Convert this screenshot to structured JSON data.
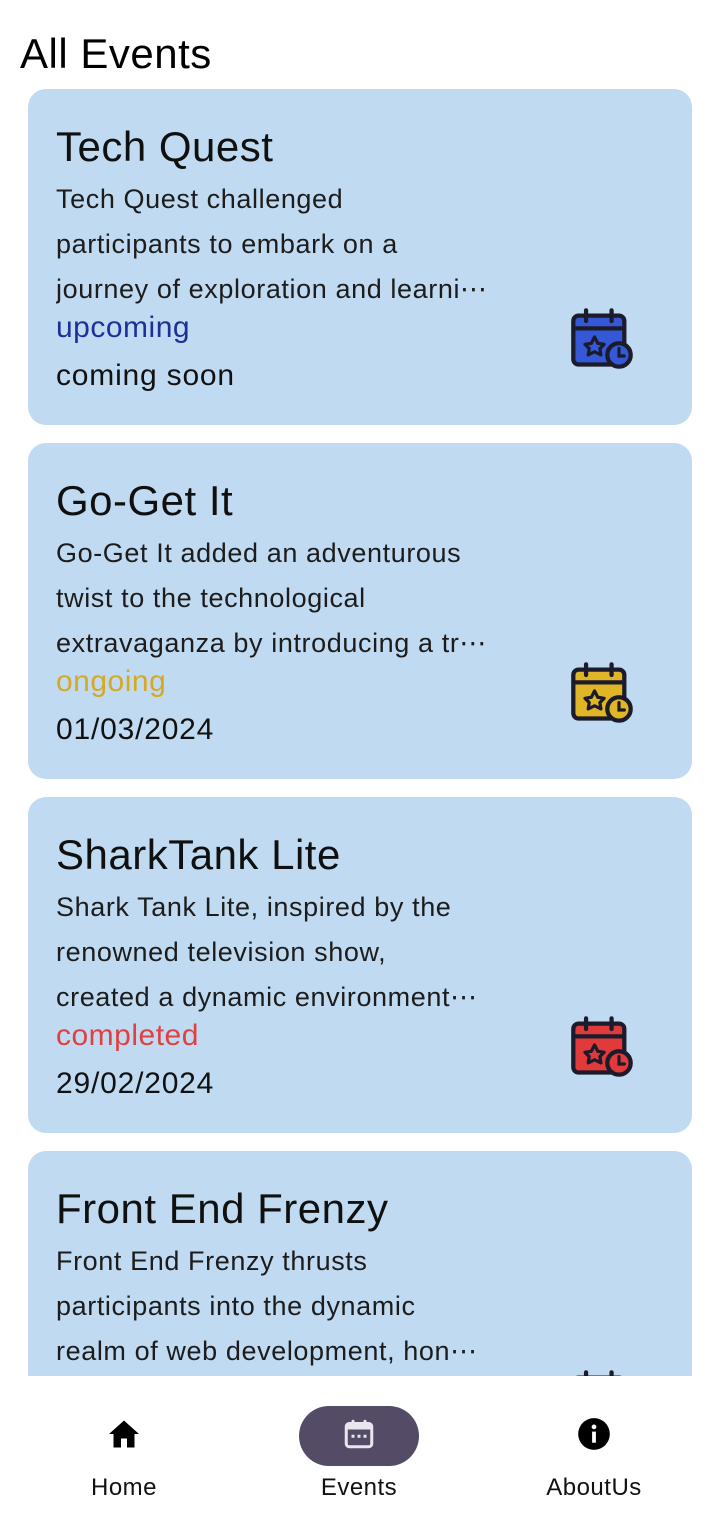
{
  "header": {
    "title": "All Events"
  },
  "events": [
    {
      "title": "Tech Quest",
      "desc_lines": [
        "Tech Quest challenged",
        "participants to embark on a",
        "journey of exploration and learni⋯"
      ],
      "status": "upcoming",
      "date": "coming soon",
      "status_color": "#1c2f9a",
      "icon_fill": "#3559d6",
      "icon": "calendar-star-icon"
    },
    {
      "title": "Go-Get It",
      "desc_lines": [
        "Go-Get It added an adventurous",
        "twist to the technological",
        "extravaganza by introducing a tr⋯"
      ],
      "status": "ongoing",
      "date": "01/03/2024",
      "status_color": "#d6a924",
      "icon_fill": "#e0b526",
      "icon": "calendar-star-icon"
    },
    {
      "title": "SharkTank Lite",
      "desc_lines": [
        "Shark Tank Lite, inspired by the",
        "renowned television show,",
        "created a dynamic environment⋯"
      ],
      "status": "completed",
      "date": "29/02/2024",
      "status_color": "#e04040",
      "icon_fill": "#e13a3a",
      "icon": "calendar-star-icon"
    },
    {
      "title": "Front End Frenzy",
      "desc_lines": [
        "Front End Frenzy thrusts",
        "participants into the dynamic",
        "realm of web development, hon⋯"
      ],
      "status": "",
      "date": "",
      "status_color": "#1c2f9a",
      "icon_fill": "#3559d6",
      "icon": "calendar-star-icon"
    }
  ],
  "nav": {
    "items": [
      {
        "label": "Home",
        "icon": "home-icon",
        "active": false
      },
      {
        "label": "Events",
        "icon": "calendar-icon",
        "active": true
      },
      {
        "label": "AboutUs",
        "icon": "info-icon",
        "active": false
      }
    ]
  }
}
